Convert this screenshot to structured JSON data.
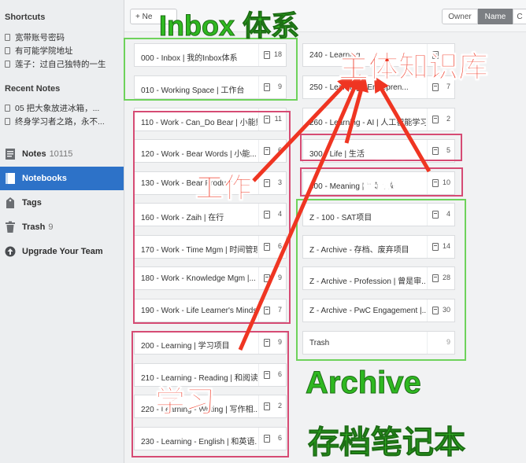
{
  "sidebar": {
    "shortcuts_title": "Shortcuts",
    "shortcuts": [
      "宽带账号密码",
      "有可能学院地址",
      "莲子：过自己独特的一生"
    ],
    "recent_title": "Recent Notes",
    "recent": [
      "05 把大象放进冰箱，...",
      "终身学习者之路，永不..."
    ],
    "nav": [
      {
        "label": "Notes",
        "count": "10115"
      },
      {
        "label": "Notebooks",
        "count": ""
      },
      {
        "label": "Tags",
        "count": ""
      },
      {
        "label": "Trash",
        "count": "9"
      },
      {
        "label": "Upgrade Your Team",
        "count": ""
      }
    ]
  },
  "toolbar": {
    "new_label": "+ Ne",
    "sort_owner": "Owner",
    "sort_name": "Name",
    "sort_c": "C"
  },
  "notebooks_left": [
    {
      "title": "000 - Inbox | 我的Inbox体系",
      "count": "18"
    },
    {
      "title": "010 - Working Space | 工作台",
      "count": "9"
    },
    {
      "title": "110 - Work - Can_Do Bear | 小能熊",
      "count": "11"
    },
    {
      "title": "120 - Work - Bear Words | 小能...",
      "count": "6"
    },
    {
      "title": "130 - Work - Bear Product",
      "count": "3"
    },
    {
      "title": "160 - Work - Zaih | 在行",
      "count": "4"
    },
    {
      "title": "170 - Work - Time Mgm | 时间管理",
      "count": "6"
    },
    {
      "title": "180 - Work - Knowledge Mgm |...",
      "count": "9"
    },
    {
      "title": "190 - Work - Life Learner's Minds...",
      "count": "7"
    },
    {
      "title": "200 - Learning | 学习项目",
      "count": "9"
    },
    {
      "title": "210 - Learning - Reading | 和阅读...",
      "count": "6"
    },
    {
      "title": "220 - Learning - Writing | 写作相...",
      "count": "2"
    },
    {
      "title": "230 - Learning - English | 和英语...",
      "count": "6"
    }
  ],
  "notebooks_right": [
    {
      "title": "240 - Learning",
      "count": ""
    },
    {
      "title": "250 - Learning - Entrepren...",
      "count": "7"
    },
    {
      "title": "260 - Learning - AI | 人工智能学习",
      "count": "2"
    },
    {
      "title": "300 - Life | 生活",
      "count": "5"
    },
    {
      "title": "400 - Meaning | 兴趣爱好",
      "count": "10"
    },
    {
      "title": "Z - 100 - SAT项目",
      "count": "4"
    },
    {
      "title": "Z - Archive - 存档、废弃项目",
      "count": "14"
    },
    {
      "title": "Z - Archive - Profession | 曾是审...",
      "count": "28"
    },
    {
      "title": "Z - Archive - PwC Engagement |...",
      "count": "30"
    },
    {
      "title": "Trash",
      "count": "9"
    }
  ],
  "annotations": {
    "inbox": "Inbox 体系",
    "core": "主体知识库",
    "life": "生活",
    "work": "工作",
    "hobby": "兴趣爱好",
    "learning": "学习",
    "archive": "Archive",
    "archive_cn": "存档笔记本"
  },
  "colors": {
    "accent": "#2d72c8",
    "green_box": "#6ed25b",
    "pink_box": "#d64b74",
    "annotation_red": "#ef3522",
    "annotation_green": "#2fb821"
  }
}
